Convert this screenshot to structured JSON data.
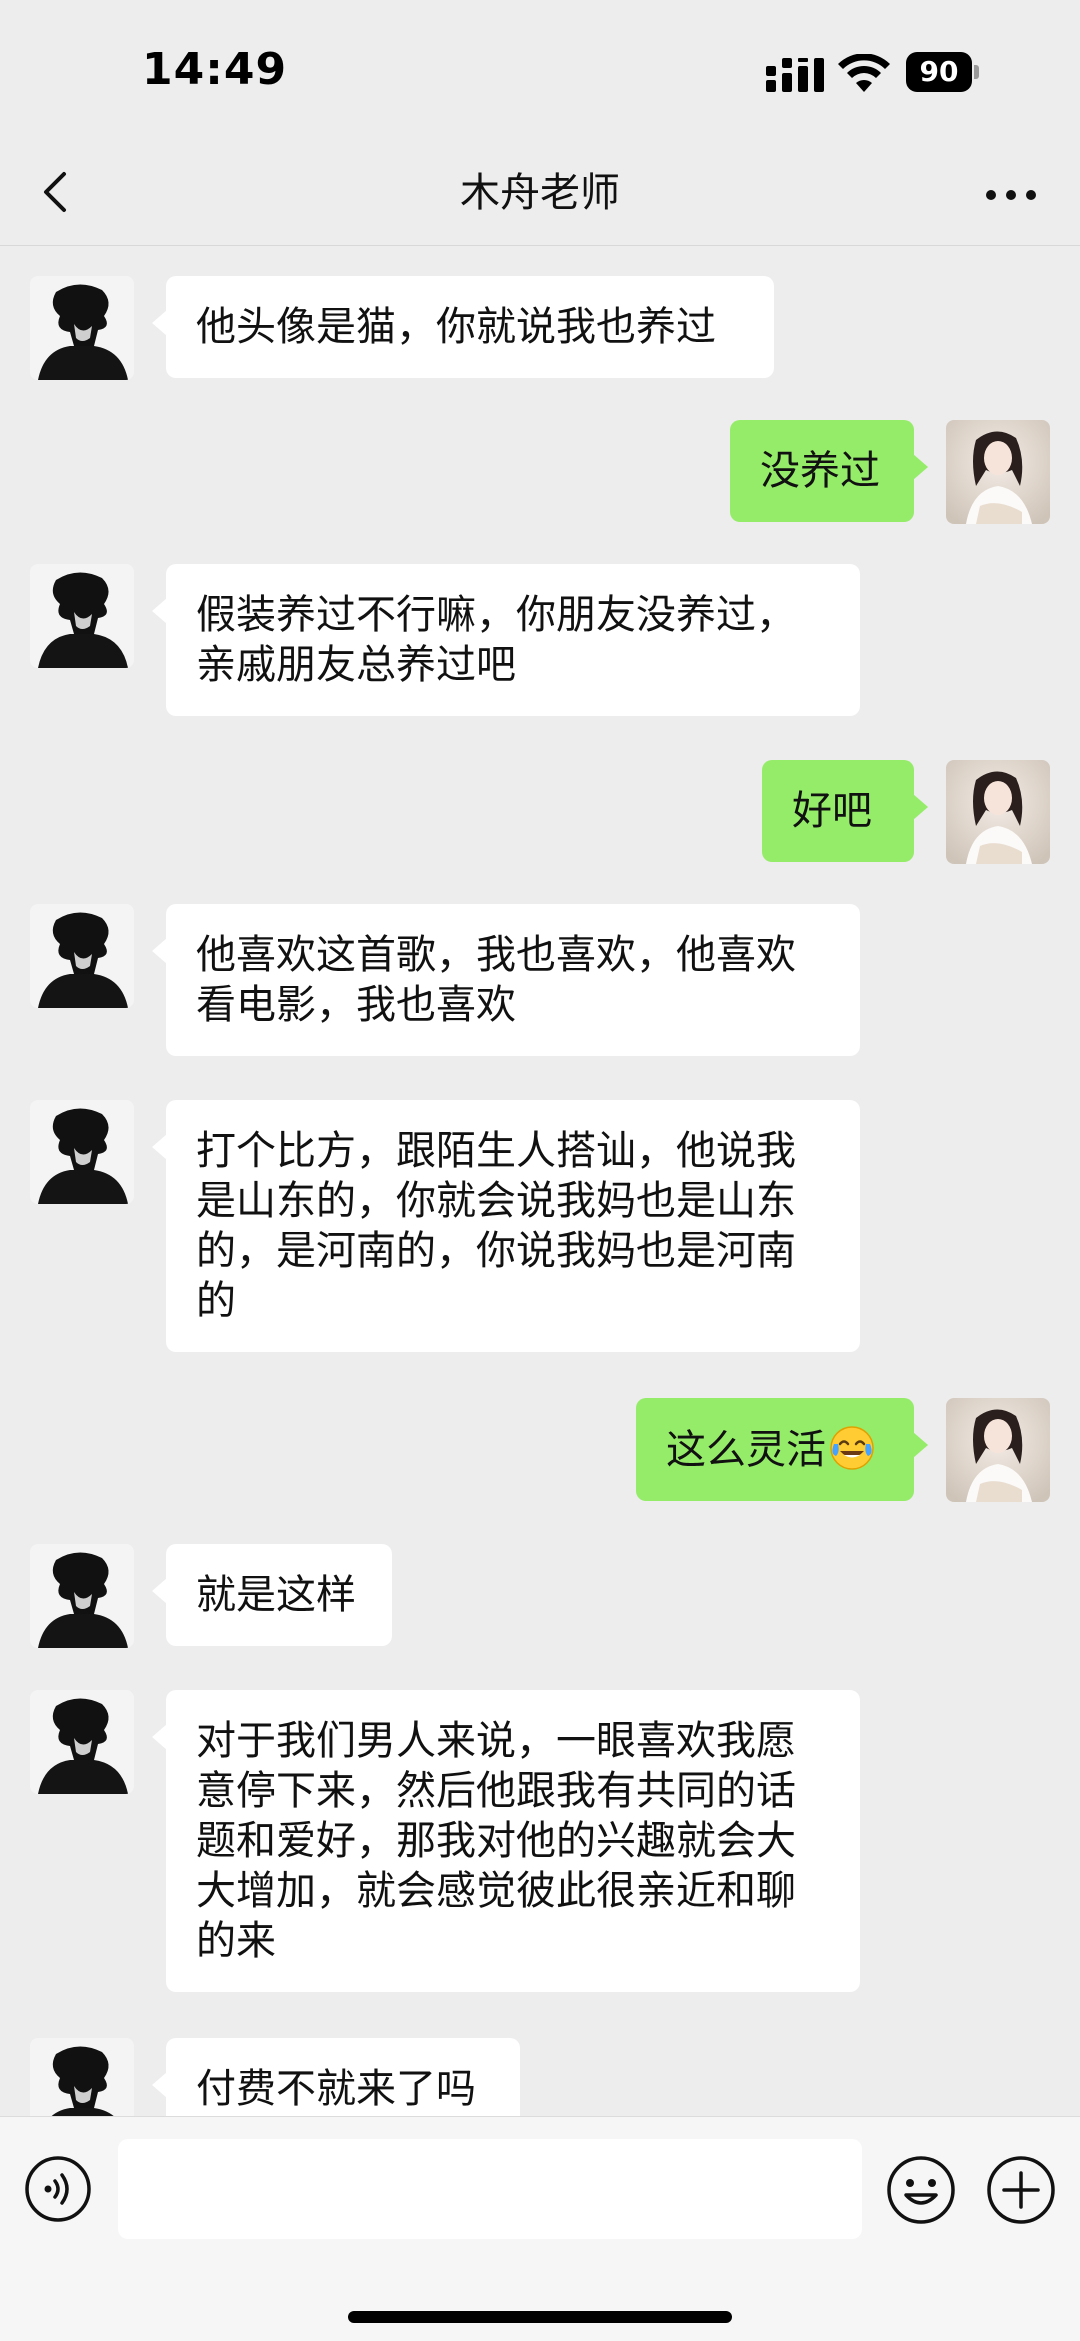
{
  "status_bar": {
    "time": "14:49",
    "battery": "90",
    "signal_icon": "cellular-signal-icon",
    "wifi_icon": "wifi-icon"
  },
  "nav": {
    "title": "木舟老师",
    "back_icon": "chevron-left-icon",
    "more_icon": "more-dots-icon"
  },
  "colors": {
    "background": "#ededed",
    "incoming_bubble": "#ffffff",
    "outgoing_bubble": "#95ec69"
  },
  "messages": [
    {
      "sender": "teacher",
      "text": "他头像是猫，你就说我也养过"
    },
    {
      "sender": "me",
      "text": "没养过"
    },
    {
      "sender": "teacher",
      "text": "假装养过不行嘛，你朋友没养过，亲戚朋友总养过吧"
    },
    {
      "sender": "me",
      "text": "好吧"
    },
    {
      "sender": "teacher",
      "text": "他喜欢这首歌，我也喜欢，他喜欢看电影，我也喜欢"
    },
    {
      "sender": "teacher",
      "text": "打个比方，跟陌生人搭讪，他说我是山东的，你就会说我妈也是山东的，是河南的，你说我妈也是河南的"
    },
    {
      "sender": "me",
      "text": "这么灵活",
      "emoji": "face-with-tears-of-joy"
    },
    {
      "sender": "teacher",
      "text": "就是这样"
    },
    {
      "sender": "teacher",
      "text": "对于我们男人来说，一眼喜欢我愿意停下来，然后他跟我有共同的话题和爱好，那我对他的兴趣就会大大增加，就会感觉彼此很亲近和聊的来"
    },
    {
      "sender": "teacher",
      "text": "付费不就来了吗"
    }
  ],
  "input_bar": {
    "value": "",
    "voice_icon": "voice-icon",
    "emoji_icon": "smiley-icon",
    "plus_icon": "plus-icon"
  }
}
